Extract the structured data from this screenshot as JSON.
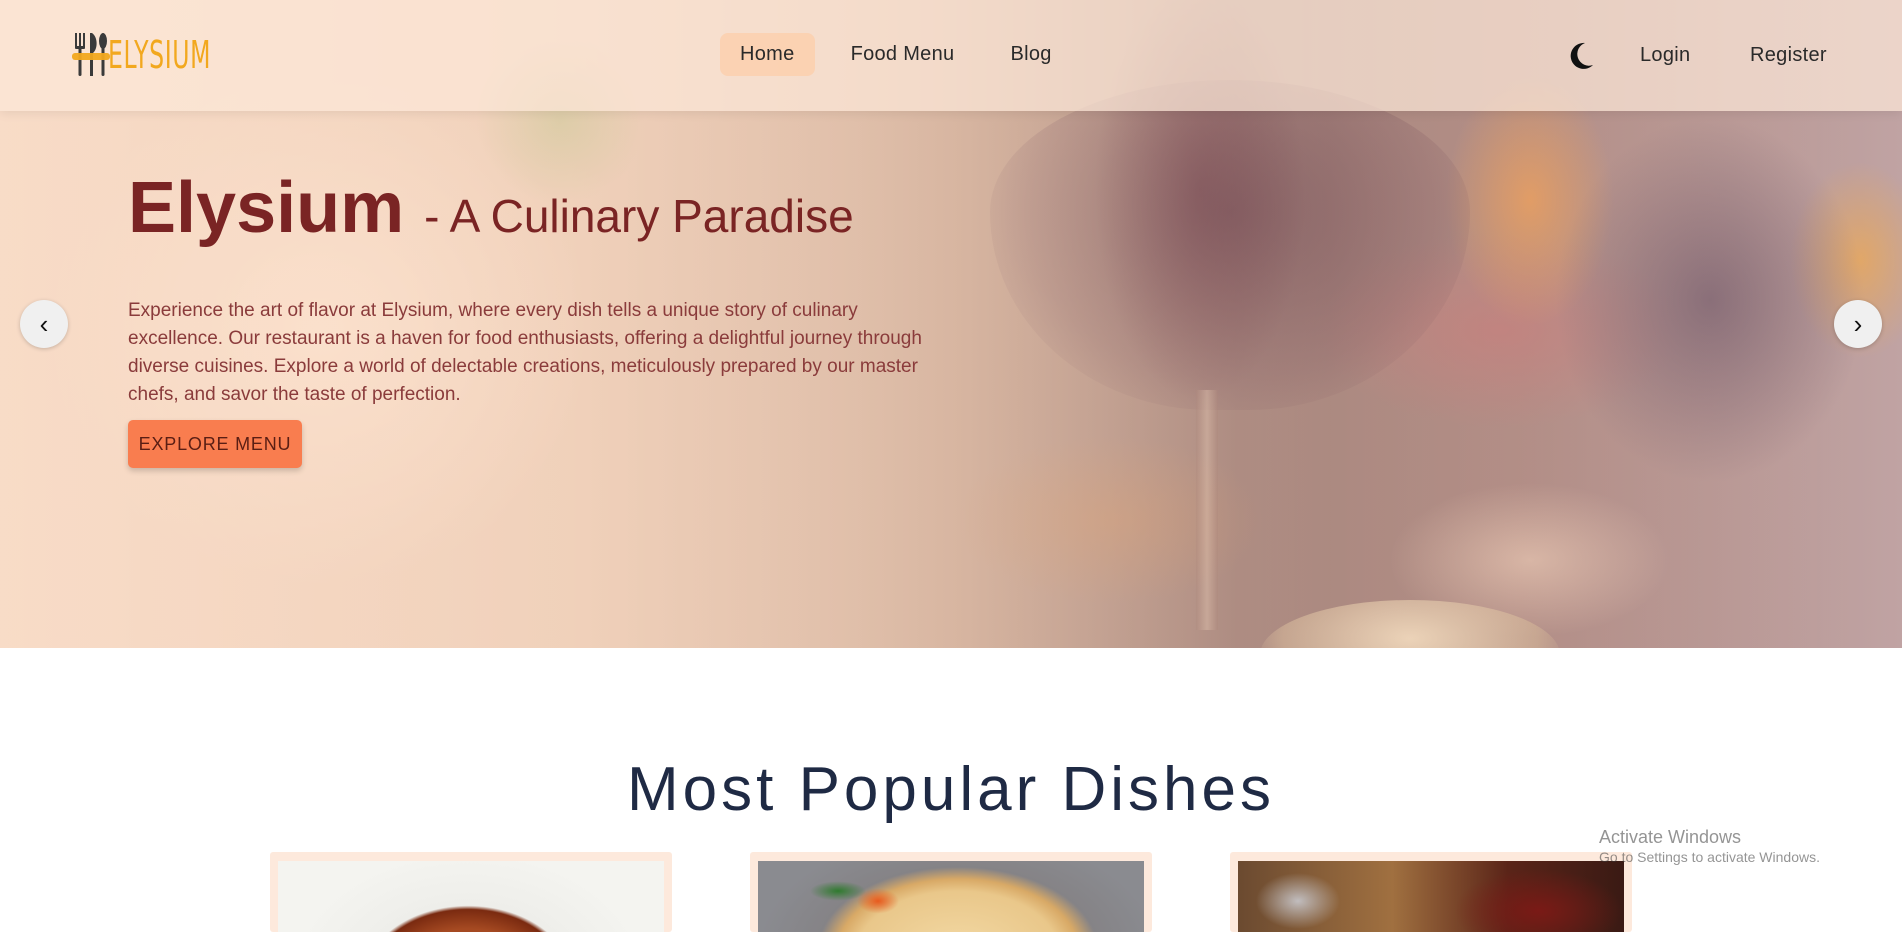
{
  "brand": {
    "logo_text": "ELYSIUM"
  },
  "nav": {
    "links": [
      {
        "label": "Home",
        "active": true
      },
      {
        "label": "Food Menu",
        "active": false
      },
      {
        "label": "Blog",
        "active": false
      }
    ],
    "theme_icon": "moon-icon",
    "login_label": "Login",
    "register_label": "Register"
  },
  "hero": {
    "brand": "Elysium",
    "tagline": "- A Culinary Paradise",
    "description": "Experience the art of flavor at Elysium, where every dish tells a unique story of culinary excellence. Our restaurant is a haven for food enthusiasts, offering a delightful journey through diverse cuisines. Explore a world of delectable creations, meticulously prepared by our master chefs, and savor the taste of perfection.",
    "cta_label": "EXPLORE MENU",
    "prev_arrow": "‹",
    "next_arrow": "›"
  },
  "popular": {
    "title": "Most Popular Dishes",
    "dishes": [
      {
        "image": "curry-bowl"
      },
      {
        "image": "noodle-plate"
      },
      {
        "image": "dessert-dish"
      }
    ]
  },
  "overlay": {
    "activate_title": "Activate Windows",
    "activate_sub": "Go to Settings to activate Windows."
  },
  "colors": {
    "brand_dark_red": "#7a2424",
    "cta_orange": "#f97d4f",
    "logo_gold": "#f2a81e",
    "active_nav_bg": "#fccdaa",
    "title_navy": "#1f2a44"
  }
}
